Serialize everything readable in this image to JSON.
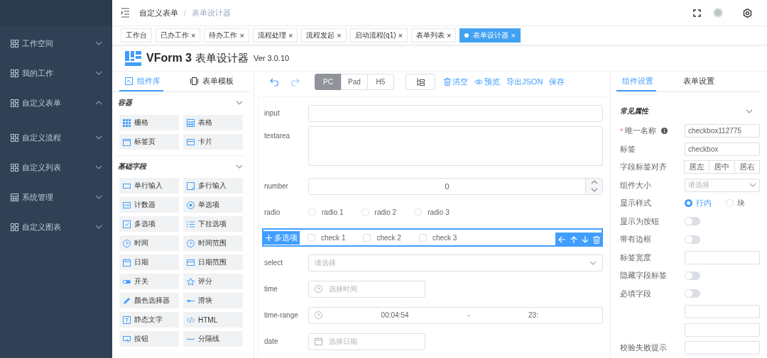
{
  "sidebar": {
    "items": [
      {
        "label": "工作空间",
        "kind": "grid",
        "expanded": false
      },
      {
        "label": "我的工作",
        "kind": "grid",
        "expanded": false
      },
      {
        "label": "自定义表单",
        "kind": "grid",
        "expanded": true
      },
      {
        "label": "自定义流程",
        "kind": "grid",
        "expanded": false
      },
      {
        "label": "自定义列表",
        "kind": "grid",
        "expanded": false
      },
      {
        "label": "系统管理",
        "kind": "table",
        "expanded": false
      },
      {
        "label": "自定义图表",
        "kind": "grid",
        "expanded": false
      }
    ]
  },
  "breadcrumb": [
    "自定义表单",
    "/",
    "表单设计器"
  ],
  "tags": [
    {
      "label": "工作台",
      "selected": false
    },
    {
      "label": "已办工作",
      "close": "×",
      "selected": false
    },
    {
      "label": "待办工作",
      "close": "×",
      "selected": false
    },
    {
      "label": "流程处理",
      "close": "×",
      "selected": false
    },
    {
      "label": "流程发起",
      "close": "×",
      "selected": false
    },
    {
      "label": "启动流程(q1)",
      "close": "×",
      "selected": false
    },
    {
      "label": "表单列表",
      "close": "×",
      "selected": false
    },
    {
      "label": "表单设计器",
      "close": "×",
      "selected": true
    }
  ],
  "app": {
    "title": "VForm 3",
    "subtitle": "表单设计器",
    "version": "Ver 3.0.10"
  },
  "left_panel": {
    "tabs": [
      {
        "label": "组件库",
        "selected": true
      },
      {
        "label": "表单模板",
        "selected": false
      }
    ],
    "groups": [
      {
        "title": "容器",
        "expanded": true,
        "items": [
          {
            "label": "栅格",
            "kind": "grid"
          },
          {
            "label": "表格",
            "kind": "table"
          },
          {
            "label": "标签页",
            "kind": "tabs"
          },
          {
            "label": "卡片",
            "kind": "card"
          }
        ]
      },
      {
        "title": "基础字段",
        "expanded": true,
        "items": [
          {
            "label": "单行输入",
            "kind": "input"
          },
          {
            "label": "多行输入",
            "kind": "textarea"
          },
          {
            "label": "计数器",
            "kind": "number"
          },
          {
            "label": "单选项",
            "kind": "radio"
          },
          {
            "label": "多选项",
            "kind": "checkbox"
          },
          {
            "label": "下拉选项",
            "kind": "list"
          },
          {
            "label": "时间",
            "kind": "clock"
          },
          {
            "label": "时间范围",
            "kind": "clock"
          },
          {
            "label": "日期",
            "kind": "calendar"
          },
          {
            "label": "日期范围",
            "kind": "card"
          },
          {
            "label": "开关",
            "kind": "switch"
          },
          {
            "label": "评分",
            "kind": "star"
          },
          {
            "label": "颜色选择器",
            "kind": "pen"
          },
          {
            "label": "滑块",
            "kind": "slider"
          },
          {
            "label": "静态文字",
            "kind": "text"
          },
          {
            "label": "HTML",
            "kind": "code"
          },
          {
            "label": "按钮",
            "kind": "button"
          },
          {
            "label": "分隔线",
            "kind": "line"
          }
        ]
      }
    ]
  },
  "toolbar": {
    "devices": [
      {
        "label": "PC",
        "selected": true
      },
      {
        "label": "Pad",
        "selected": false
      },
      {
        "label": "H5",
        "selected": false
      }
    ],
    "actions": [
      {
        "label": "清空",
        "kind": "trash"
      },
      {
        "label": "预览",
        "kind": "eye"
      },
      {
        "label": "导出JSON",
        "kind": "plain"
      },
      {
        "label": "保存",
        "kind": "plain"
      }
    ]
  },
  "form": {
    "fields": [
      {
        "kind": "input",
        "label": "input",
        "selected": false
      },
      {
        "kind": "textarea",
        "label": "textarea",
        "selected": false
      },
      {
        "kind": "number",
        "label": "number",
        "value": "0",
        "selected": false
      },
      {
        "kind": "radio",
        "label": "radio",
        "selected": false,
        "options": [
          {
            "label": "radio 1",
            "checked": false
          },
          {
            "label": "radio 2",
            "checked": false
          },
          {
            "label": "radio 3",
            "checked": false
          }
        ]
      },
      {
        "kind": "checkbox",
        "badge": "多选项",
        "selected": true,
        "options": [
          {
            "label": "check 1",
            "checked": false
          },
          {
            "label": "check 2",
            "checked": false
          },
          {
            "label": "check 3",
            "checked": false
          }
        ]
      },
      {
        "kind": "select",
        "label": "select",
        "placeholder": "请选择",
        "selected": false
      },
      {
        "kind": "time",
        "label": "time",
        "placeholder": "选择时间",
        "selected": false
      },
      {
        "kind": "time-range",
        "label": "time-range",
        "start": "00:04:54",
        "separator": "-",
        "end": "23:",
        "selected": false
      },
      {
        "kind": "date",
        "label": "date",
        "placeholder": "选择日期",
        "selected": false
      }
    ]
  },
  "settings": {
    "tabs": [
      {
        "label": "组件设置",
        "selected": true
      },
      {
        "label": "表单设置",
        "selected": false
      }
    ],
    "section": {
      "title": "常见属性",
      "expanded": true
    },
    "rows": [
      {
        "kind": "input",
        "required_mark": "*",
        "label": "唯一名称",
        "info": true,
        "value": "checkbox112775"
      },
      {
        "kind": "input",
        "label": "标签",
        "value": "checkbox"
      },
      {
        "kind": "segmented",
        "label": "字段标签对齐",
        "options": [
          {
            "label": "居左",
            "selected": false
          },
          {
            "label": "居中",
            "selected": false
          },
          {
            "label": "居右",
            "selected": false
          }
        ]
      },
      {
        "kind": "select",
        "label": "组件大小",
        "placeholder": "请选择"
      },
      {
        "kind": "radio",
        "label": "显示样式",
        "options": [
          {
            "label": "行内",
            "checked": true
          },
          {
            "label": "块",
            "checked": false
          }
        ]
      },
      {
        "kind": "switch",
        "label": "显示为按钮",
        "on": false
      },
      {
        "kind": "switch",
        "label": "带有边框",
        "on": false
      },
      {
        "kind": "input",
        "label": "标签宽度"
      },
      {
        "kind": "switch",
        "label": "隐藏字段标签",
        "on": false
      },
      {
        "kind": "switch",
        "label": "必填字段",
        "on": false
      },
      {
        "kind": "input"
      },
      {
        "kind": "input"
      },
      {
        "kind": "input",
        "label": "校验失败提示"
      }
    ]
  }
}
